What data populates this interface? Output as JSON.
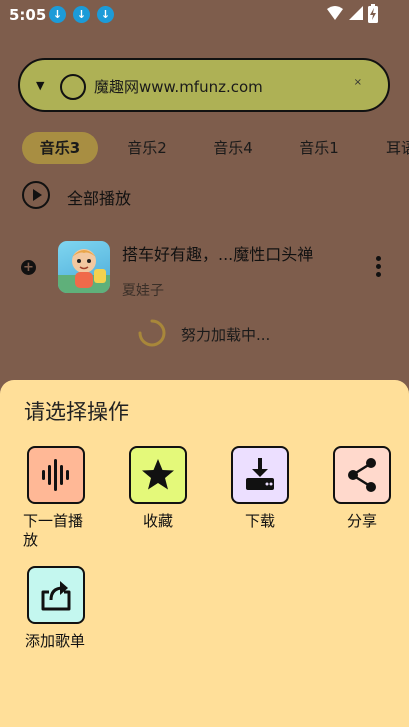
{
  "status_bar": {
    "time": "5:05",
    "download_icons": [
      "download-icon",
      "download-icon",
      "download-icon"
    ],
    "right_icons": [
      "wifi-icon",
      "signal-icon",
      "battery-icon"
    ]
  },
  "search": {
    "value": "魔趣网www.mfunz.com",
    "clear_symbol": "×"
  },
  "tabs": [
    {
      "label": "音乐3",
      "active": true
    },
    {
      "label": "音乐2",
      "active": false
    },
    {
      "label": "音乐4",
      "active": false
    },
    {
      "label": "音乐1",
      "active": false
    },
    {
      "label": "耳语",
      "active": false
    }
  ],
  "play_all": {
    "label": "全部播放"
  },
  "song": {
    "title": "搭车好有趣，...魔性口头禅",
    "artist": "夏娃子"
  },
  "loading": {
    "label": "努力加载中..."
  },
  "sheet": {
    "title": "请选择操作",
    "actions": [
      {
        "label": "下一首播放",
        "icon": "waveform-icon",
        "color": "#ffb896"
      },
      {
        "label": "收藏",
        "icon": "star-icon",
        "color": "#e4f97a"
      },
      {
        "label": "下载",
        "icon": "download-tray-icon",
        "color": "#ecdfff"
      },
      {
        "label": "分享",
        "icon": "share-icon",
        "color": "#ffd9cc"
      },
      {
        "label": "添加歌单",
        "icon": "add-to-playlist-icon",
        "color": "#c4f7ef"
      }
    ]
  }
}
